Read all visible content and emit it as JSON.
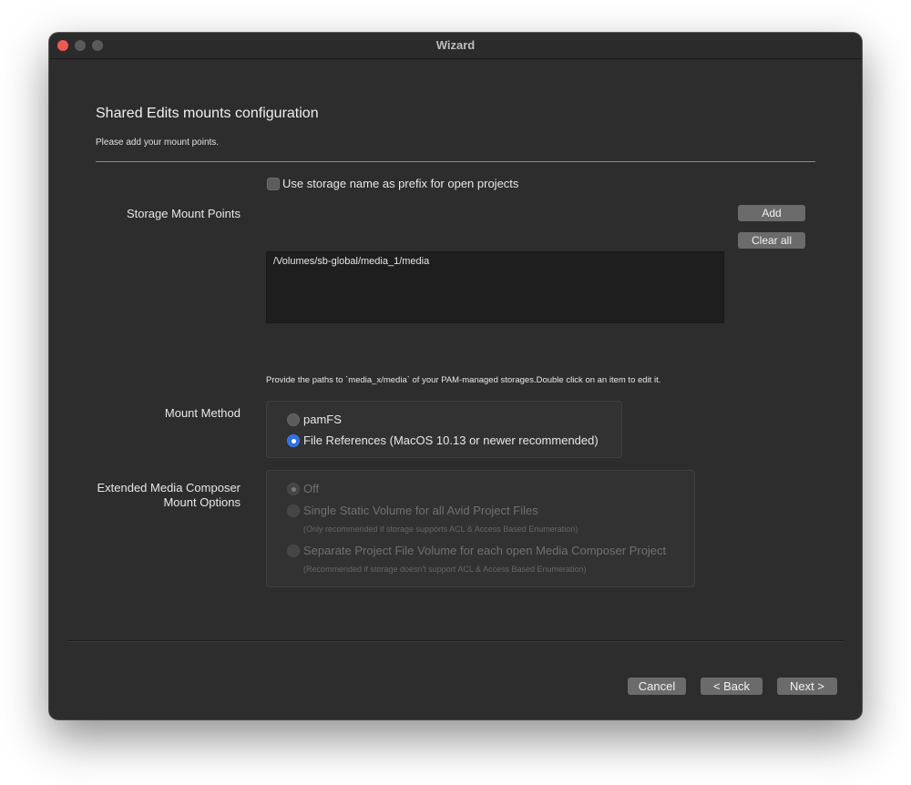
{
  "window": {
    "title": "Wizard"
  },
  "page": {
    "heading": "Shared Edits mounts configuration",
    "subheading": "Please add your mount points."
  },
  "prefix_option": {
    "label": "Use storage name as prefix for open projects",
    "checked": false
  },
  "storage": {
    "label": "Storage Mount Points",
    "add_label": "Add",
    "clear_label": "Clear all",
    "items": [
      "/Volumes/sb-global/media_1/media"
    ],
    "hint": "Provide the paths to `media_x/media` of your PAM-managed storages.Double click on an item to edit it."
  },
  "mount_method": {
    "label": "Mount Method",
    "options": [
      {
        "label": "pamFS",
        "selected": false
      },
      {
        "label": "File References (MacOS 10.13 or newer recommended)",
        "selected": true
      }
    ]
  },
  "extended": {
    "label_line1": "Extended Media Composer",
    "label_line2": "Mount Options",
    "options": [
      {
        "label": "Off",
        "note": "",
        "selected": true,
        "enabled": false
      },
      {
        "label": "Single Static Volume for all Avid Project Files",
        "note": "(Only recommended if storage supports ACL & Access Based Enumeration)",
        "selected": false,
        "enabled": false
      },
      {
        "label": "Separate Project File Volume for each open Media Composer Project",
        "note": "(Recommended if storage doesn't support ACL & Access Based Enumeration)",
        "selected": false,
        "enabled": false
      }
    ]
  },
  "footer": {
    "cancel_label": "Cancel",
    "back_label": "< Back",
    "next_label": "Next >"
  },
  "colors": {
    "window_bg": "#2d2d2d",
    "accent": "#2f6fdf",
    "close": "#ee5a52"
  }
}
